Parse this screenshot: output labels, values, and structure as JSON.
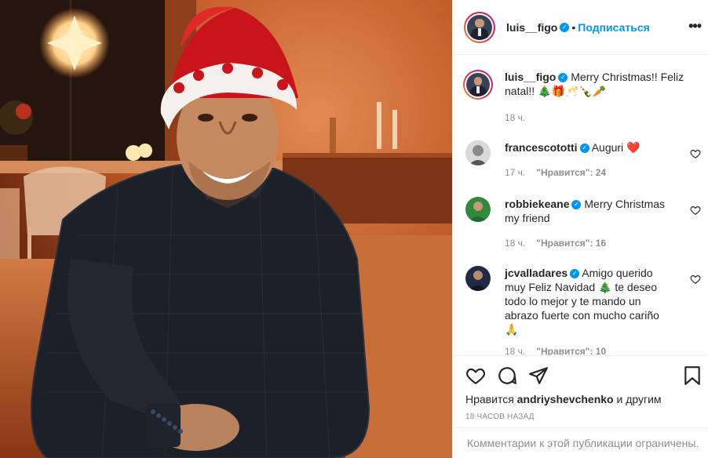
{
  "post": {
    "author": "luis__figo",
    "follow_label": "Подписаться",
    "dot": "•",
    "more": "•••"
  },
  "caption": {
    "username": "luis__figo",
    "text": "Merry Christmas!! Feliz natal!! 🎄🎁🥂🍾🥕",
    "time": "18 ч."
  },
  "comments": [
    {
      "username": "francescototti",
      "text": "Auguri ❤️",
      "time": "17 ч.",
      "likes": "\"Нравится\": 24"
    },
    {
      "username": "robbiekeane",
      "text": "Merry Christmas my friend",
      "time": "18 ч.",
      "likes": "\"Нравится\": 16"
    },
    {
      "username": "jcvalladares",
      "text": "Amigo querido muy Feliz Navidad 🎄 te deseo todo lo mejor y te mando un abrazo fuerte con mucho cariño 🙏",
      "time": "18 ч.",
      "likes": "\"Нравится\": 10"
    }
  ],
  "likes": {
    "prefix": "Нравится",
    "user": "andriyshevchenko",
    "suffix": "и другим"
  },
  "timestamp": "18 ЧАСОВ НАЗАД",
  "footer": "Комментарии к этой публикации ограничены.",
  "icons": [
    "heart-icon",
    "comment-icon",
    "share-icon",
    "bookmark-icon",
    "more-icon",
    "verified-icon"
  ],
  "colors": {
    "accent": "#0095f6",
    "text": "#262626",
    "muted": "#8e8e8e",
    "heart_red": "#ed4956"
  }
}
